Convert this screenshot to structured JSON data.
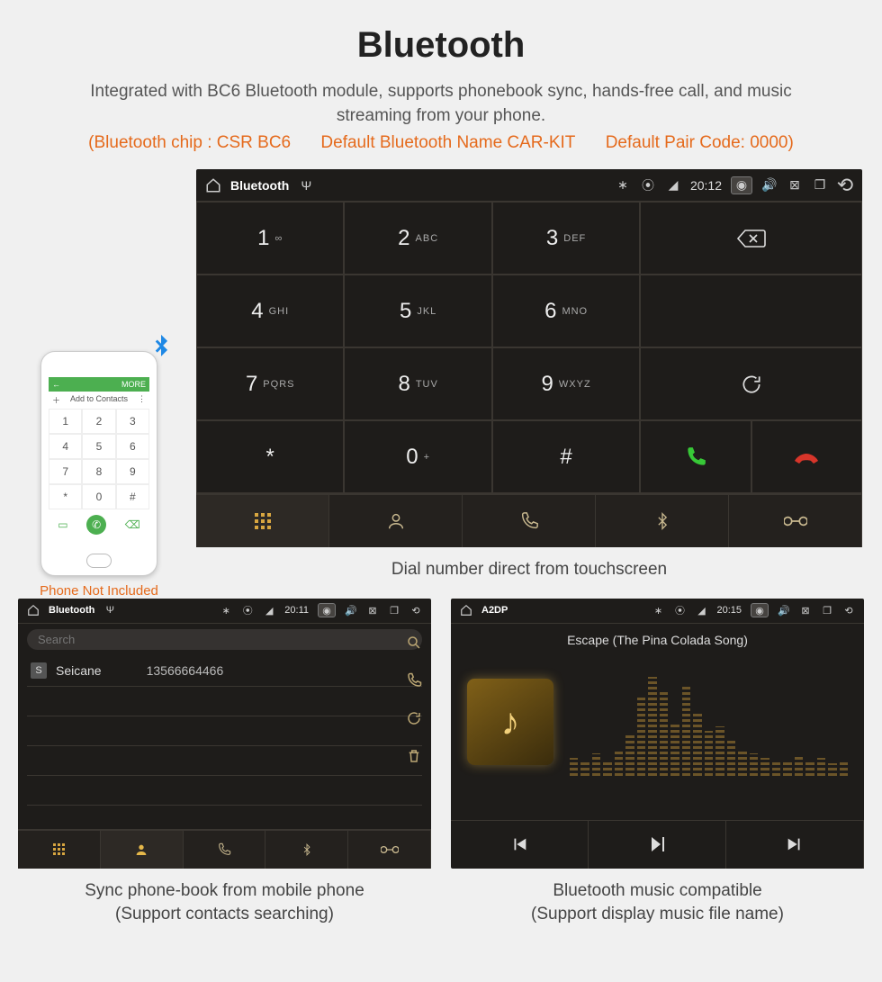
{
  "header": {
    "title": "Bluetooth",
    "description": "Integrated with BC6 Bluetooth module, supports phonebook sync, hands-free call, and music streaming from your phone.",
    "spec_chip": "(Bluetooth chip : CSR BC6",
    "spec_name": "Default Bluetooth Name CAR-KIT",
    "spec_code": "Default Pair Code: 0000)"
  },
  "phone_mock": {
    "appbar_back": "←",
    "appbar_more": "MORE",
    "add_contacts": "Add to Contacts",
    "note": "Phone Not Included"
  },
  "dialer": {
    "status": {
      "title": "Bluetooth",
      "time": "20:12"
    },
    "keys": [
      {
        "d": "1",
        "s": "∞"
      },
      {
        "d": "2",
        "s": "ABC"
      },
      {
        "d": "3",
        "s": "DEF"
      },
      {
        "d": "4",
        "s": "GHI"
      },
      {
        "d": "5",
        "s": "JKL"
      },
      {
        "d": "6",
        "s": "MNO"
      },
      {
        "d": "7",
        "s": "PQRS"
      },
      {
        "d": "8",
        "s": "TUV"
      },
      {
        "d": "9",
        "s": "WXYZ"
      },
      {
        "d": "*",
        "s": ""
      },
      {
        "d": "0",
        "s": "+"
      },
      {
        "d": "#",
        "s": ""
      }
    ],
    "caption": "Dial number direct from touchscreen"
  },
  "phonebook": {
    "status": {
      "title": "Bluetooth",
      "time": "20:11"
    },
    "search_placeholder": "Search",
    "contacts": [
      {
        "initial": "S",
        "name": "Seicane",
        "number": "13566664466"
      }
    ],
    "caption_l1": "Sync phone-book from mobile phone",
    "caption_l2": "(Support contacts searching)"
  },
  "music": {
    "status": {
      "title": "A2DP",
      "time": "20:15"
    },
    "song": "Escape (The Pina Colada Song)",
    "caption_l1": "Bluetooth music compatible",
    "caption_l2": "(Support display music file name)"
  }
}
